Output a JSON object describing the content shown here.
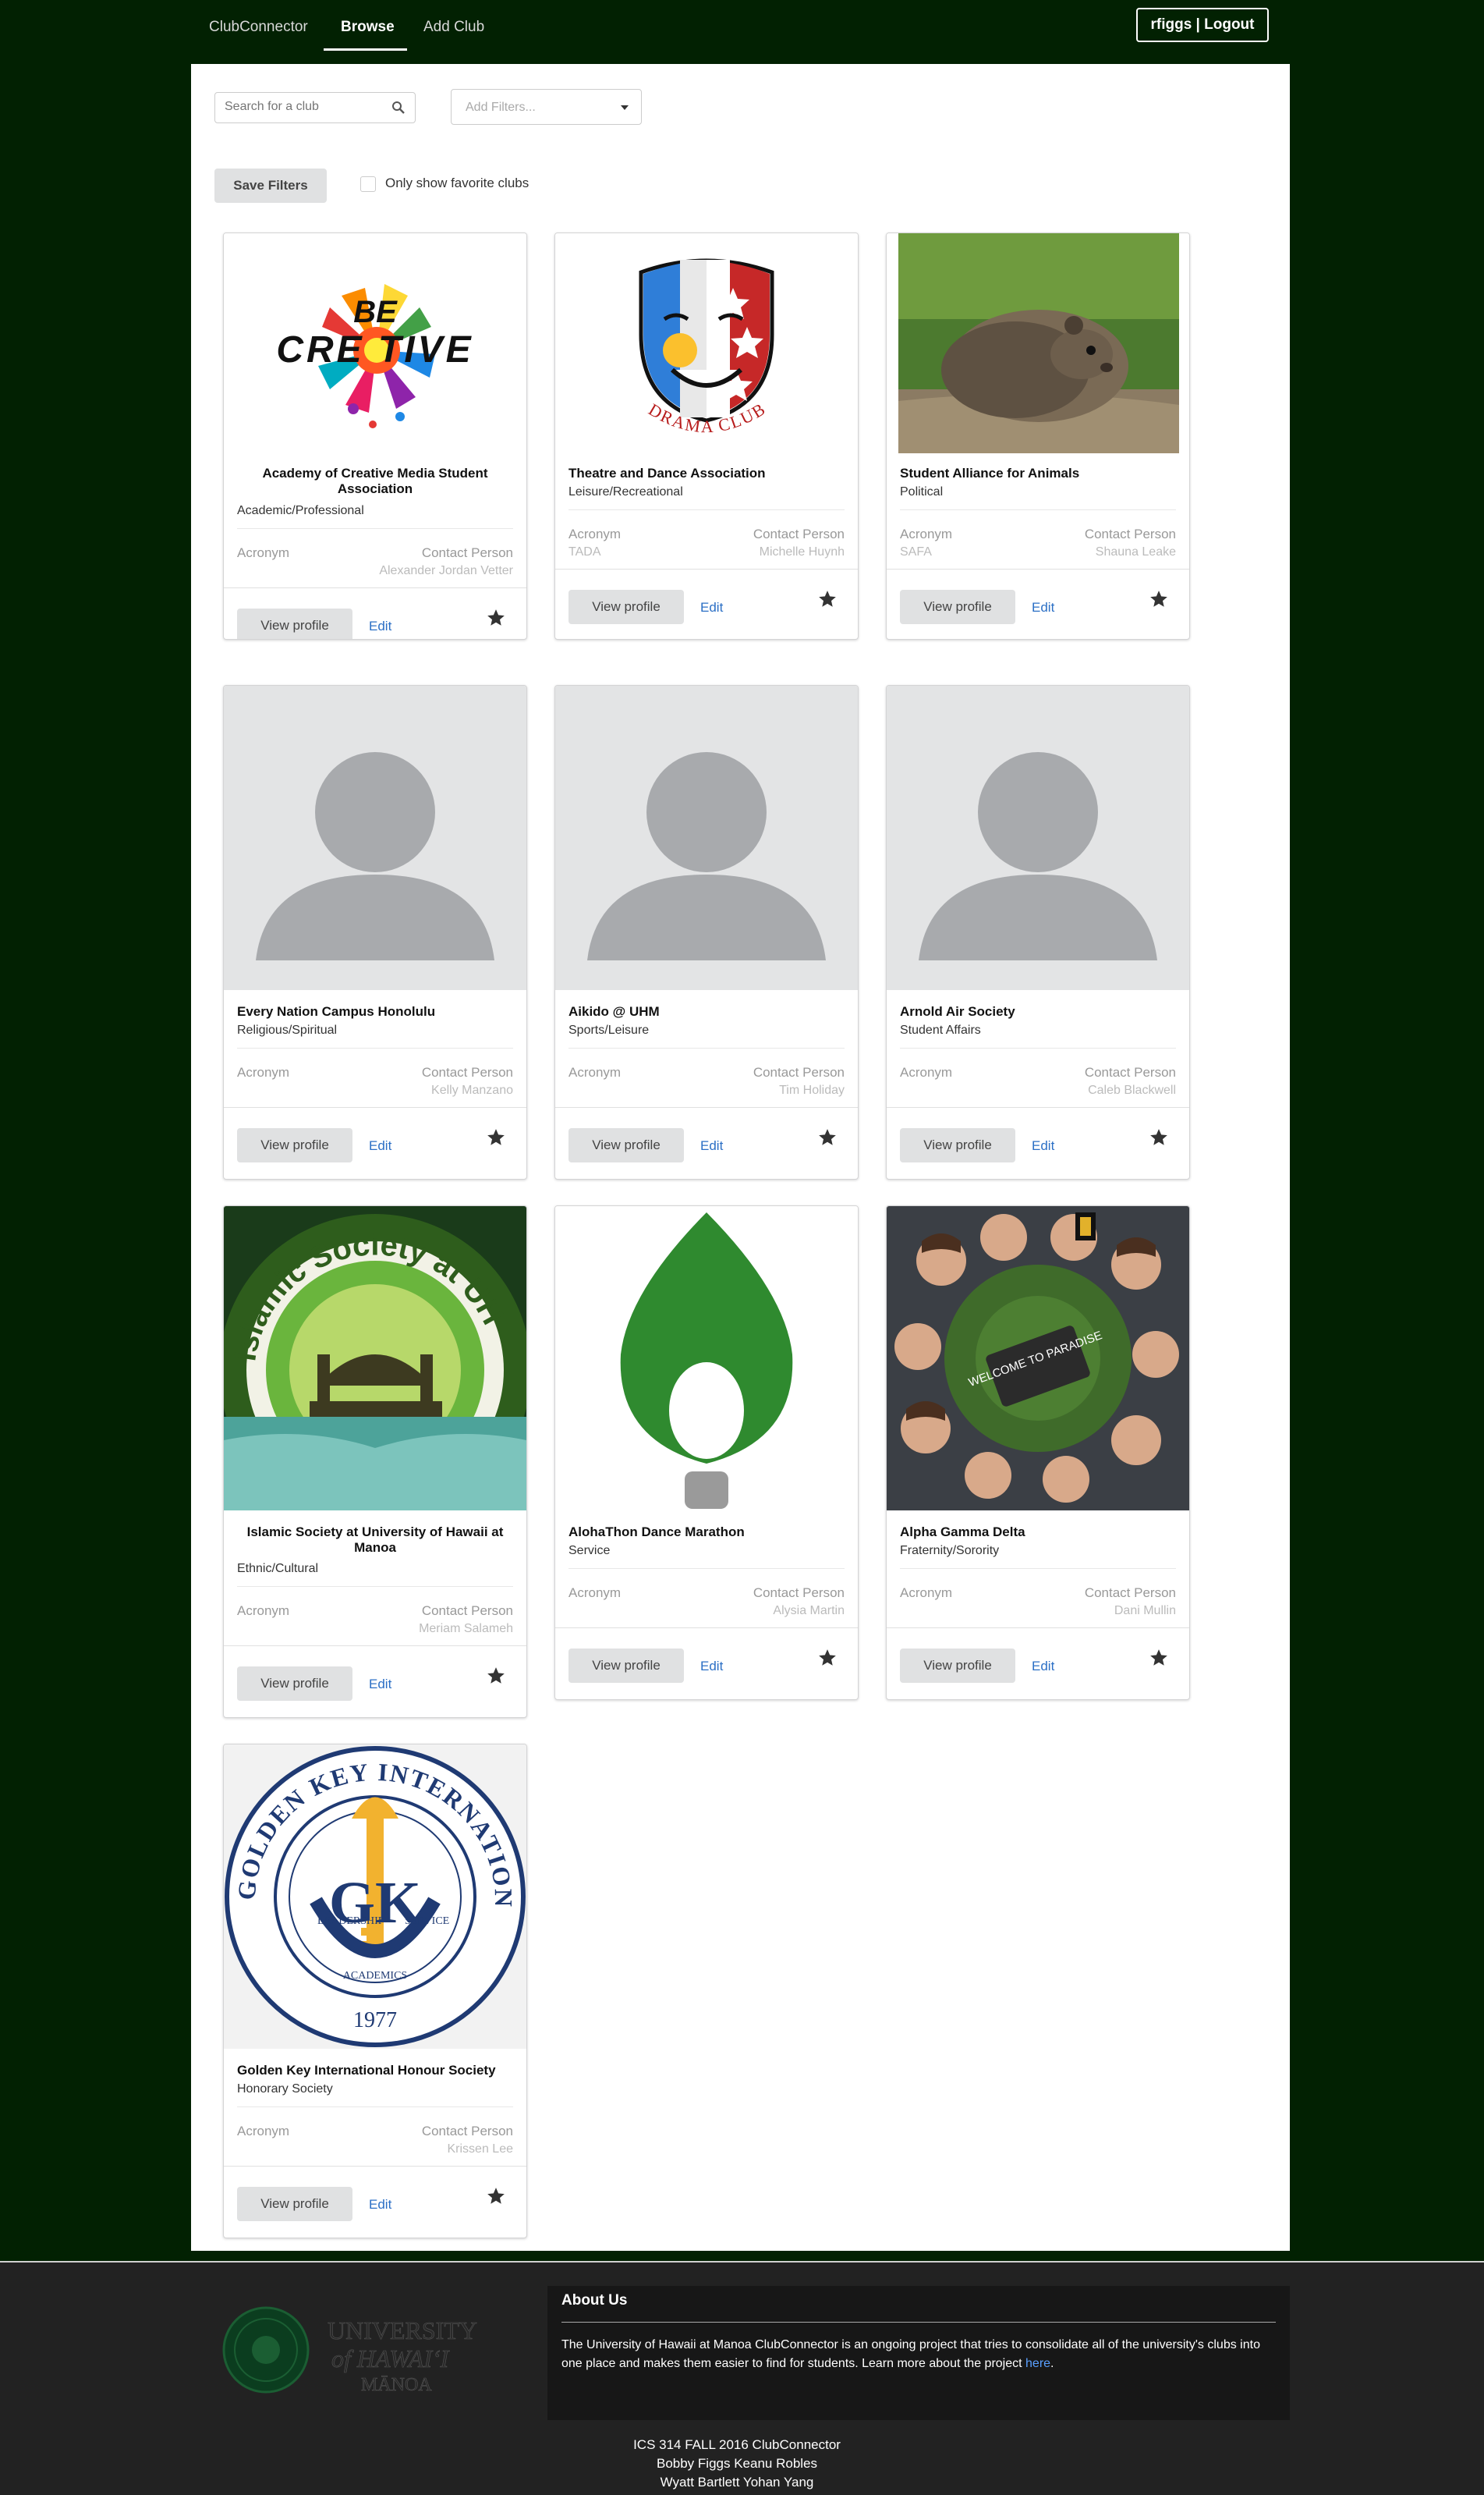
{
  "nav": {
    "brand": "ClubConnector",
    "browse": "Browse",
    "add_club": "Add Club",
    "user_button": "rfiggs | Logout"
  },
  "controls": {
    "search_placeholder": "Search for a club",
    "filters_placeholder": "Add Filters...",
    "save_filters": "Save Filters",
    "only_favorites": "Only show favorite clubs",
    "only_favorites_checked": false
  },
  "card_labels": {
    "acronym": "Acronym",
    "contact_person": "Contact Person",
    "view_profile": "View profile",
    "edit": "Edit"
  },
  "clubs": [
    {
      "name": "Academy of Creative Media Student Association",
      "category": "Academic/Professional",
      "acronym": "",
      "contact": "Alexander Jordan Vetter",
      "image": "be-creative-logo"
    },
    {
      "name": "Theatre and Dance Association",
      "category": "Leisure/Recreational",
      "acronym": "TADA",
      "contact": "Michelle Huynh",
      "image": "drama-club-mask-logo"
    },
    {
      "name": "Student Alliance for Animals",
      "category": "Political",
      "acronym": "SAFA",
      "contact": "Shauna Leake",
      "image": "guinea-pig-photo"
    },
    {
      "name": "Every Nation Campus Honolulu",
      "category": "Religious/Spiritual",
      "acronym": "",
      "contact": "Kelly Manzano",
      "image": "placeholder-avatar"
    },
    {
      "name": "Aikido @ UHM",
      "category": "Sports/Leisure",
      "acronym": "",
      "contact": "Tim Holiday",
      "image": "placeholder-avatar"
    },
    {
      "name": "Arnold Air Society",
      "category": "Student Affairs",
      "acronym": "",
      "contact": "Caleb Blackwell",
      "image": "placeholder-avatar"
    },
    {
      "name": "Islamic Society at University of Hawaii at Manoa",
      "category": "Ethnic/Cultural",
      "acronym": "",
      "contact": "Meriam Salameh",
      "image": "islamic-society-logo",
      "logo_text": "Islamic Society at UH"
    },
    {
      "name": "AlohaThon Dance Marathon",
      "category": "Service",
      "acronym": "",
      "contact": "Alysia Martin",
      "image": "green-flame-logo"
    },
    {
      "name": "Alpha Gamma Delta",
      "category": "Fraternity/Sorority",
      "acronym": "",
      "contact": "Dani Mullin",
      "image": "group-photo",
      "sign_text": "WELCOME TO PARADISE"
    },
    {
      "name": "Golden Key International Honour Society",
      "category": "Honorary Society",
      "acronym": "",
      "contact": "Krissen Lee",
      "image": "golden-key-seal",
      "seal_text": "GOLDEN KEY INTERNATIONAL HONOUR SOCIETY",
      "seal_letters": "GK",
      "seal_year": "1977",
      "seal_words": [
        "LEADERSHIP",
        "SERVICE",
        "ACADEMICS"
      ]
    }
  ],
  "footer": {
    "logo_text": [
      "UNIVERSITY",
      "of HAWAI‘I",
      "MĀNOA"
    ],
    "about_title": "About Us",
    "about_text": "The University of Hawaii at Manoa ClubConnector is an ongoing project that tries to consolidate all of the university's clubs into one place and makes them easier to find for students. Learn more about the project ",
    "about_link": "here",
    "about_end": ".",
    "credits": [
      "ICS 314 FALL 2016 ClubConnector",
      "Bobby Figgs Keanu Robles",
      "Wyatt Bartlett Yohan Yang"
    ]
  },
  "colors": {
    "page_bg": "#022102",
    "link": "#2b6fc5",
    "button_gray": "#e0e1e2",
    "footer_bg": "#222222"
  }
}
